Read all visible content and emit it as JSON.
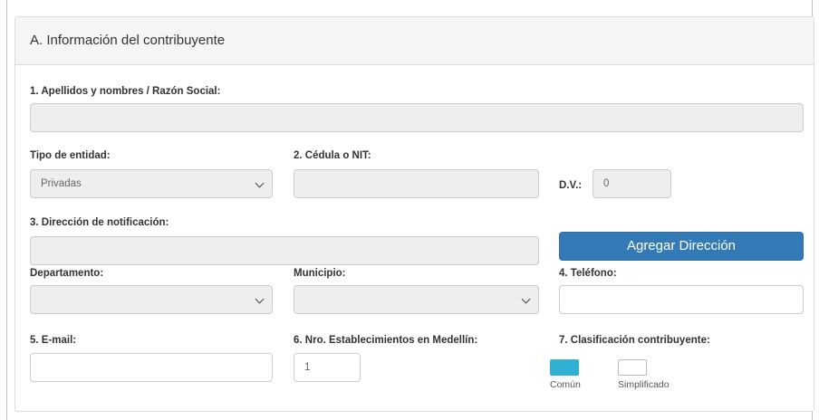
{
  "section": {
    "title": "A. Información del contribuyente"
  },
  "labels": {
    "razon_social": "1. Apellidos y nombres / Razón Social:",
    "tipo_entidad": "Tipo de entidad:",
    "cedula_nit": "2. Cédula o NIT:",
    "dv": "D.V.:",
    "direccion": "3. Dirección de notificación:",
    "departamento": "Departamento:",
    "municipio": "Municipio:",
    "telefono": "4. Teléfono:",
    "email": "5. E-mail:",
    "nro_establecimientos": "6. Nro. Establecimientos en Medellín:",
    "clasificacion": "7. Clasificación contribuyente:"
  },
  "fields": {
    "razon_social": "",
    "tipo_entidad": "Privadas",
    "cedula_nit": "",
    "dv": "0",
    "direccion": "",
    "departamento": "",
    "municipio": "",
    "telefono": "",
    "email": "",
    "nro_establecimientos": "1"
  },
  "buttons": {
    "agregar_direccion": "Agregar Dirección"
  },
  "clasificacion_options": [
    {
      "label": "Común",
      "color": "#31b0d5",
      "selected": true
    },
    {
      "label": "Simplificado",
      "color": "#ffffff",
      "selected": false
    }
  ],
  "colors": {
    "primary": "#337ab7",
    "selected_option": "#31b0d5",
    "disabled_bg": "#eeeeee"
  }
}
